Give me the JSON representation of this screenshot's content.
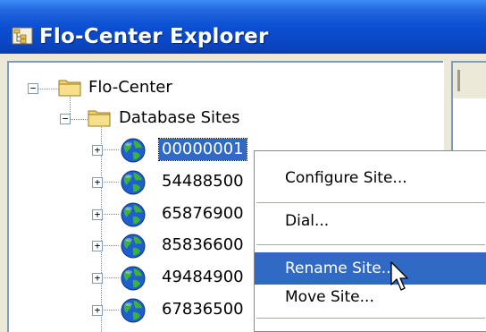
{
  "window": {
    "title": "Flo-Center Explorer",
    "title_icon": "explorer-tree-icon"
  },
  "tree": {
    "root_label": "Flo-Center",
    "child_label": "Database Sites",
    "sites": [
      {
        "label": "00000001",
        "selected": true
      },
      {
        "label": "54488500",
        "selected": false
      },
      {
        "label": "65876900",
        "selected": false
      },
      {
        "label": "85836600",
        "selected": false
      },
      {
        "label": "49484900",
        "selected": false
      },
      {
        "label": "67836500",
        "selected": false
      }
    ]
  },
  "context_menu": {
    "items": [
      {
        "label": "Configure Site..."
      },
      {
        "label": "Dial..."
      },
      {
        "label": "Rename Site...",
        "hover": true
      },
      {
        "label": "Move Site..."
      }
    ]
  },
  "colors": {
    "titlebar": "#0A46C4",
    "selection": "#316AC5",
    "window_bg": "#ECE9D8"
  }
}
